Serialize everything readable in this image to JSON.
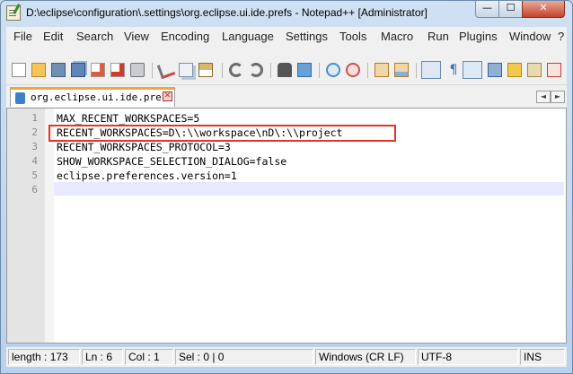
{
  "window": {
    "title": "D:\\eclipse\\configuration\\.settings\\org.eclipse.ui.ide.prefs - Notepad++ [Administrator]",
    "minimize_glyph": "—",
    "maximize_glyph": "☐",
    "close_glyph": "✕"
  },
  "menu": [
    "File",
    "Edit",
    "Search",
    "View",
    "Encoding",
    "Language",
    "Settings",
    "Tools",
    "Macro",
    "Run",
    "Plugins",
    "Window",
    "?"
  ],
  "tab": {
    "label": "org.eclipse.ui.ide.prefs",
    "close_glyph": "✕"
  },
  "tab_nav": {
    "left": "◄",
    "right": "►"
  },
  "editor": {
    "line_numbers": [
      "1",
      "2",
      "3",
      "4",
      "5",
      "6"
    ],
    "lines": [
      "MAX_RECENT_WORKSPACES=5",
      "RECENT_WORKSPACES=D\\:\\\\workspace\\nD\\:\\\\project",
      "RECENT_WORKSPACES_PROTOCOL=3",
      "SHOW_WORKSPACE_SELECTION_DIALOG=false",
      "eclipse.preferences.version=1",
      ""
    ]
  },
  "status": {
    "length": "length : 173",
    "ln": "Ln : 6",
    "col": "Col : 1",
    "sel": "Sel : 0 | 0",
    "eol": "Windows (CR LF)",
    "encoding": "UTF-8",
    "mode": "INS"
  },
  "colors": {
    "highlight_box": "#e0342d",
    "tab_accent": "#f5a33b",
    "current_line": "#e8e8ff"
  },
  "toolbar_icons": [
    "new-file-icon",
    "open-file-icon",
    "save-icon",
    "save-all-icon",
    "close-icon",
    "close-all-icon",
    "print-icon",
    "cut-icon",
    "copy-icon",
    "paste-icon",
    "undo-icon",
    "redo-icon",
    "find-icon",
    "replace-icon",
    "zoom-in-icon",
    "zoom-out-icon",
    "sync-vertical-icon",
    "sync-horizontal-icon",
    "word-wrap-icon",
    "show-all-chars-icon",
    "indent-guide-icon",
    "doc-map-icon",
    "function-list-icon",
    "folder-workspace-icon",
    "record-macro-icon"
  ]
}
